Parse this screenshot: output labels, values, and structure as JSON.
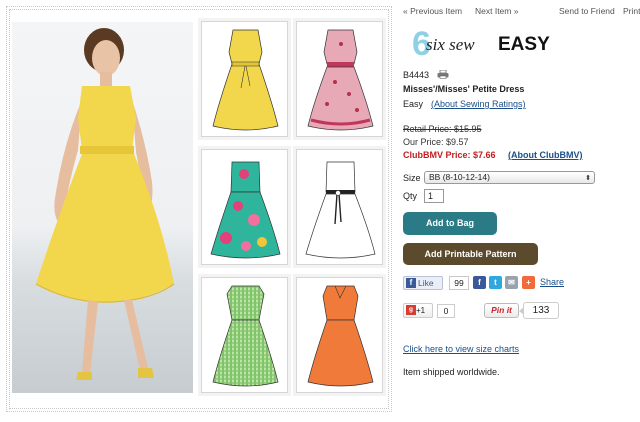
{
  "nav": {
    "prev_label": "« Previous Item",
    "next_label": "Next Item »",
    "send_label": "Send to Friend",
    "print_label": "Print"
  },
  "logo": {
    "text": "six sew EASY",
    "number": "6",
    "word_a": "six sew",
    "word_b": "EASY"
  },
  "product": {
    "sku": "B4443",
    "title": "Misses'/Misses' Petite Dress",
    "difficulty": "Easy",
    "ratings_link": "(About Sewing Ratings)"
  },
  "prices": {
    "retail": "Retail Price: $15.95",
    "ours": "Our Price: $9.57",
    "club": "ClubBMV Price: $7.66",
    "club_link": "(About ClubBMV)"
  },
  "form": {
    "size_label": "Size",
    "size_value": "BB (8-10-12-14)",
    "qty_label": "Qty",
    "qty_value": "1"
  },
  "buttons": {
    "add_to_bag": "Add to Bag",
    "add_pattern": "Add Printable Pattern"
  },
  "social": {
    "like_label": "Like",
    "like_count": "99",
    "share_label": "Share",
    "gplus_label": "+1",
    "gplus_count": "0",
    "pinit_label": "Pin it",
    "pin_count": "133"
  },
  "footer": {
    "size_chart_link": "Click here to view size charts",
    "shipped": "Item shipped worldwide."
  },
  "colors": {
    "accent_teal": "#2a7b86",
    "accent_brown": "#5b4a2b",
    "club_red": "#c41e1e",
    "link_blue": "#1a4f8a",
    "dress_yellow": "#f2d64b"
  }
}
